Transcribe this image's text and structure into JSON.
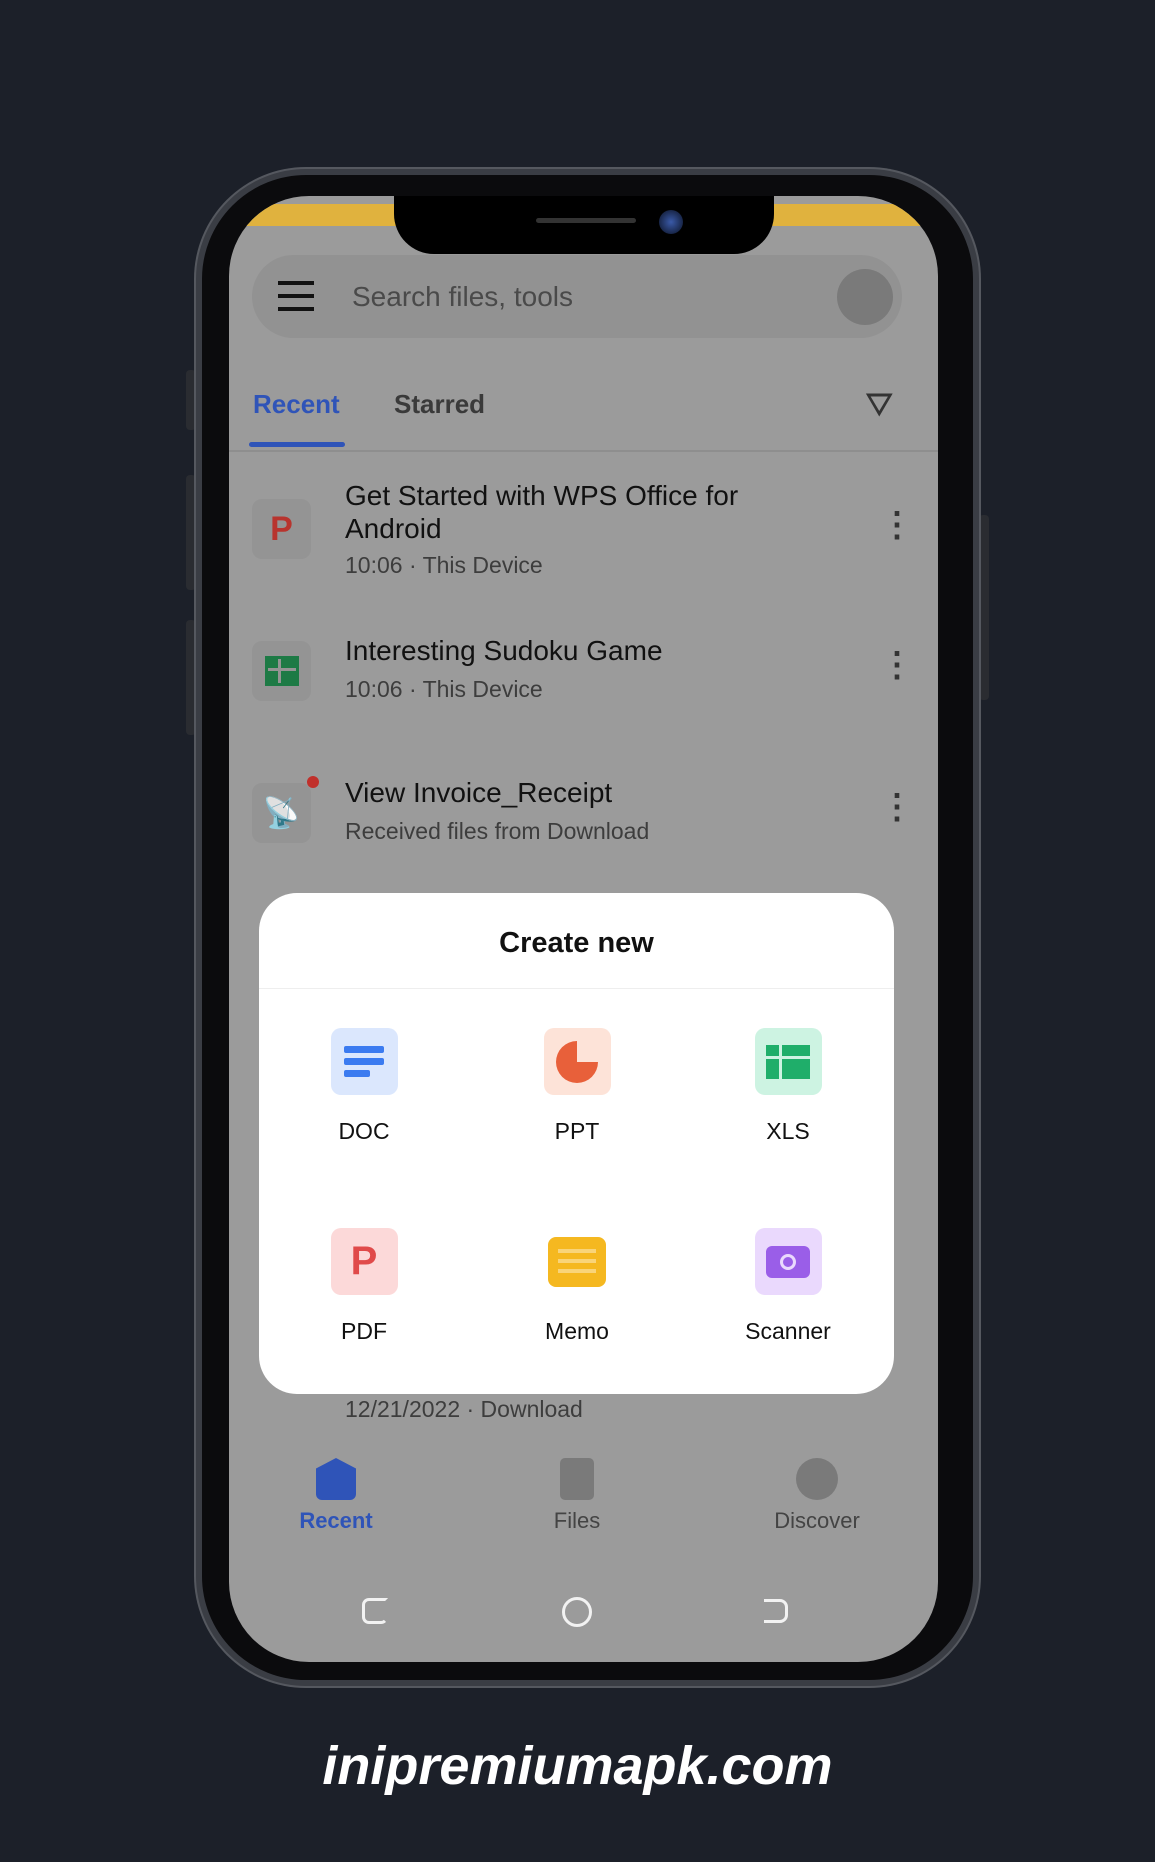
{
  "search": {
    "placeholder": "Search files, tools"
  },
  "tabs": [
    {
      "label": "Recent",
      "active": true
    },
    {
      "label": "Starred",
      "active": false
    }
  ],
  "files": [
    {
      "title_line1": "Get Started with WPS Office for",
      "title_line2": "Android",
      "subtitle": "10:06 · This Device",
      "icon": "pdf-icon"
    },
    {
      "title_line1": "Interesting Sudoku Game",
      "subtitle": "10:06 · This Device",
      "icon": "xls-icon"
    },
    {
      "title_line1": "View Invoice_Receipt",
      "subtitle": "Received files from Download",
      "icon": "receive-icon",
      "unread_dot": true
    },
    {
      "subtitle": "12/21/2022 · Download"
    }
  ],
  "dialog": {
    "title": "Create new",
    "items": [
      {
        "label": "DOC",
        "icon": "doc-icon",
        "color": "#3b7bf0"
      },
      {
        "label": "PPT",
        "icon": "ppt-icon",
        "color": "#e8603a"
      },
      {
        "label": "XLS",
        "icon": "xls-icon",
        "color": "#1fae6a"
      },
      {
        "label": "PDF",
        "icon": "pdf-icon",
        "color": "#e04a4a"
      },
      {
        "label": "Memo",
        "icon": "memo-icon",
        "color": "#f5b820"
      },
      {
        "label": "Scanner",
        "icon": "camera-icon",
        "color": "#9a5ee8"
      }
    ]
  },
  "bottom_nav": [
    {
      "label": "Recent",
      "active": true
    },
    {
      "label": "Files"
    },
    {
      "label": "Discover"
    }
  ],
  "colors": {
    "accent": "#2f54b8",
    "background": "#1c2029"
  },
  "watermark": "inipremiumapk.com"
}
